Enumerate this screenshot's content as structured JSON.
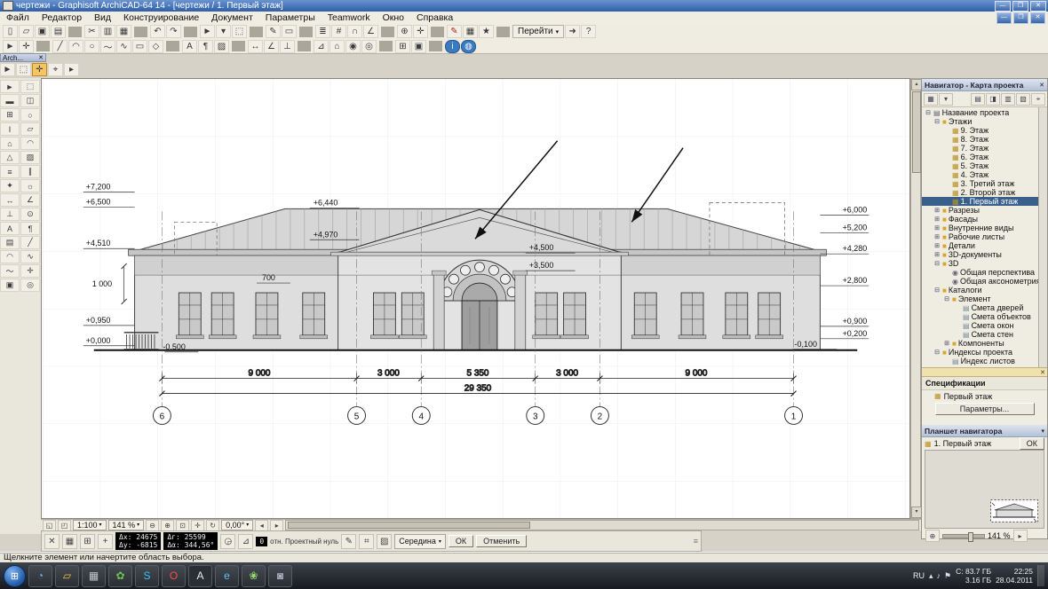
{
  "window": {
    "title": "чертежи - Graphisoft ArchiCAD-64 14 - [чертежи / 1. Первый этаж]"
  },
  "glyphs": {
    "close": "✕",
    "min": "—",
    "max": "❐",
    "dropdown": "▾",
    "up": "▴",
    "down": "▾",
    "left": "◂",
    "right": "▸",
    "grip": "≡",
    "start": "⊞",
    "plus": "+",
    "lens_minus": "⊖",
    "lens_plus": "⊕"
  },
  "menu": {
    "items": [
      {
        "name": "menu-file",
        "label": "Файл"
      },
      {
        "name": "menu-edit",
        "label": "Редактор"
      },
      {
        "name": "menu-view",
        "label": "Вид"
      },
      {
        "name": "menu-design",
        "label": "Конструирование"
      },
      {
        "name": "menu-document",
        "label": "Документ"
      },
      {
        "name": "menu-options",
        "label": "Параметры"
      },
      {
        "name": "menu-teamwork",
        "label": "Teamwork"
      },
      {
        "name": "menu-window",
        "label": "Окно"
      },
      {
        "name": "menu-help",
        "label": "Справка"
      }
    ]
  },
  "toolbar1": {
    "goto": "Перейти",
    "items": [
      {
        "n": "new-icon",
        "g": "▯"
      },
      {
        "n": "open-icon",
        "g": "▱"
      },
      {
        "n": "save-icon",
        "g": "▣"
      },
      {
        "n": "print-icon",
        "g": "▤"
      },
      {
        "cls": "sep",
        "g": ""
      },
      {
        "n": "cut-icon",
        "g": "✂"
      },
      {
        "n": "copy-icon",
        "g": "▥"
      },
      {
        "n": "paste-icon",
        "g": "▦"
      },
      {
        "cls": "sep",
        "g": ""
      },
      {
        "n": "undo-icon",
        "g": "↶"
      },
      {
        "n": "redo-icon",
        "g": "↷"
      },
      {
        "cls": "sep",
        "g": ""
      },
      {
        "n": "arrow-tool-icon",
        "g": "►"
      },
      {
        "n": "arrow-dropdown-icon",
        "g": "▾"
      },
      {
        "n": "marquee-tool-icon",
        "g": "⬚"
      },
      {
        "cls": "sep",
        "g": ""
      },
      {
        "n": "pen-icon",
        "g": "✎"
      },
      {
        "n": "eraser-icon",
        "g": "▭"
      },
      {
        "cls": "sep",
        "g": ""
      },
      {
        "n": "layers-icon",
        "g": "≣"
      },
      {
        "n": "grid-snap-icon",
        "g": "#"
      },
      {
        "n": "magnet-icon",
        "g": "∩"
      },
      {
        "n": "guideline-icon",
        "g": "∠"
      },
      {
        "cls": "sep",
        "g": ""
      },
      {
        "n": "zoom-icon",
        "g": "⊕"
      },
      {
        "n": "pan-icon",
        "g": "✛"
      },
      {
        "cls": "sep",
        "g": ""
      },
      {
        "n": "markup-pen-icon",
        "g": "✎",
        "cls": "c-red"
      },
      {
        "n": "schedule-icon",
        "g": "▦"
      },
      {
        "n": "favorites-icon",
        "g": "★"
      },
      {
        "cls": "sep",
        "g": ""
      }
    ],
    "items2": [
      {
        "n": "run-icon",
        "g": "➜"
      },
      {
        "n": "help-icon",
        "g": "?"
      }
    ]
  },
  "toolbar2": {
    "items": [
      {
        "n": "select-icon",
        "g": "►"
      },
      {
        "n": "hotspot-icon",
        "g": "✛"
      },
      {
        "cls": "sep",
        "g": ""
      },
      {
        "n": "line-icon",
        "g": "╱"
      },
      {
        "n": "arc-icon",
        "g": "◠"
      },
      {
        "n": "circle-icon",
        "g": "○"
      },
      {
        "n": "spline-icon",
        "g": "～"
      },
      {
        "n": "polyline-icon",
        "g": "∿"
      },
      {
        "n": "rect-icon",
        "g": "▭"
      },
      {
        "n": "poly-icon",
        "g": "◇"
      },
      {
        "cls": "sep",
        "g": ""
      },
      {
        "n": "text-icon",
        "g": "A"
      },
      {
        "n": "label-icon",
        "g": "¶"
      },
      {
        "n": "fill-icon",
        "g": "▨"
      },
      {
        "cls": "sep",
        "g": ""
      },
      {
        "n": "dimension-icon",
        "g": "↔"
      },
      {
        "n": "angle-dimension-icon",
        "g": "∠"
      },
      {
        "n": "level-dimension-icon",
        "g": "⊥"
      },
      {
        "cls": "sep",
        "g": ""
      },
      {
        "n": "section-icon",
        "g": "⊿"
      },
      {
        "n": "elevation-icon",
        "g": "⌂"
      },
      {
        "n": "detail-icon",
        "g": "◉"
      },
      {
        "n": "camera-icon",
        "g": "◎"
      },
      {
        "cls": "sep",
        "g": ""
      },
      {
        "n": "column-grid-icon",
        "g": "⊞"
      },
      {
        "n": "drawing-icon",
        "g": "▣"
      },
      {
        "cls": "sep",
        "g": ""
      },
      {
        "n": "info-icon",
        "g": "i",
        "cls": "c-blue"
      },
      {
        "n": "teamwork-icon",
        "g": "◍",
        "cls": "c-blue"
      }
    ]
  },
  "palette": {
    "title": "Arch...",
    "items": [
      {
        "n": "quick-arrow-icon",
        "g": "►"
      },
      {
        "n": "quick-marquee-icon",
        "g": "⬚"
      },
      {
        "n": "quick-select-icon",
        "g": "✛",
        "cls": "active"
      },
      {
        "n": "quick-snap-icon",
        "g": "⌖"
      },
      {
        "n": "quick-cursor-icon",
        "g": "▸"
      }
    ]
  },
  "toolbox": {
    "items": [
      {
        "n": "tool-arrow",
        "g": "►"
      },
      {
        "n": "tool-marquee",
        "g": "⬚"
      },
      {
        "n": "tool-wall",
        "g": "▬"
      },
      {
        "n": "tool-door",
        "g": "◫"
      },
      {
        "n": "tool-window",
        "g": "⊞"
      },
      {
        "n": "tool-column",
        "g": "○"
      },
      {
        "n": "tool-beam",
        "g": "Ι"
      },
      {
        "n": "tool-slab",
        "g": "▱"
      },
      {
        "n": "tool-roof",
        "g": "⌂"
      },
      {
        "n": "tool-shell",
        "g": "◠"
      },
      {
        "n": "tool-mesh",
        "g": "△"
      },
      {
        "n": "tool-zone",
        "g": "▨"
      },
      {
        "n": "tool-stair",
        "g": "≡"
      },
      {
        "n": "tool-railing",
        "g": "∥"
      },
      {
        "n": "tool-object",
        "g": "✦"
      },
      {
        "n": "tool-lamp",
        "g": "☼"
      },
      {
        "n": "tool-dimension",
        "g": "↔"
      },
      {
        "n": "tool-angle-dimension",
        "g": "∠"
      },
      {
        "n": "tool-level-dimension",
        "g": "⊥"
      },
      {
        "n": "tool-radial-dimension",
        "g": "⊙"
      },
      {
        "n": "tool-text",
        "g": "A"
      },
      {
        "n": "tool-label",
        "g": "¶"
      },
      {
        "n": "tool-fill",
        "g": "▤"
      },
      {
        "n": "tool-line",
        "g": "╱"
      },
      {
        "n": "tool-arc",
        "g": "◠"
      },
      {
        "n": "tool-polyline",
        "g": "∿"
      },
      {
        "n": "tool-spline",
        "g": "～"
      },
      {
        "n": "tool-hotspot",
        "g": "✛"
      },
      {
        "n": "tool-figure",
        "g": "▣"
      },
      {
        "n": "tool-camera",
        "g": "◎"
      }
    ]
  },
  "drawing": {
    "levels_left": [
      "+7,200",
      "+6,500",
      "+4,510",
      "+0,950",
      "+0,000"
    ],
    "levels_right": [
      "+6,000",
      "+5,200",
      "+4,280",
      "+2,800",
      "+0,900",
      "+0,200"
    ],
    "marks": {
      "ridge": "+6,440",
      "eaves": "+4,970",
      "left_dim": "700",
      "arch_top": "+4,500",
      "arch_spring": "+3,500",
      "left_vert": "1 000",
      "base_left": "-0,500",
      "base_right": "-0,100"
    },
    "dims": [
      "9 000",
      "3 000",
      "5 350",
      "3 000",
      "9 000"
    ],
    "dim_total": "29 350",
    "axes": [
      "6",
      "5",
      "4",
      "3",
      "2",
      "1"
    ]
  },
  "navigator": {
    "title": "Навигатор - Карта проекта",
    "header_icons_left": [
      {
        "n": "project-chooser-icon",
        "g": "▦"
      },
      {
        "n": "project-dropdown-icon",
        "g": "▾"
      }
    ],
    "header_icons_right": [
      {
        "n": "project-map-icon",
        "g": "▤"
      },
      {
        "n": "view-map-icon",
        "g": "◨"
      },
      {
        "n": "layout-book-icon",
        "g": "▥"
      },
      {
        "n": "publisher-icon",
        "g": "▧"
      },
      {
        "n": "pin-icon",
        "g": "⌖"
      }
    ],
    "tree": [
      {
        "name": "nav-project-name",
        "label": "Название проекта",
        "cls": "d0",
        "icon": "i-book",
        "ig": "▤",
        "exp": "⊟"
      },
      {
        "name": "nav-stories",
        "label": "Этажи",
        "cls": "d1",
        "icon": "i-folder",
        "ig": "■",
        "exp": "⊟"
      },
      {
        "name": "nav-story-9",
        "label": "9. Этаж",
        "cls": "d2",
        "icon": "i-floor",
        "ig": "▦",
        "exp": ""
      },
      {
        "name": "nav-story-8",
        "label": "8. Этаж",
        "cls": "d2",
        "icon": "i-floor",
        "ig": "▦",
        "exp": ""
      },
      {
        "name": "nav-story-7",
        "label": "7. Этаж",
        "cls": "d2",
        "icon": "i-floor",
        "ig": "▦",
        "exp": ""
      },
      {
        "name": "nav-story-6",
        "label": "6. Этаж",
        "cls": "d2",
        "icon": "i-floor",
        "ig": "▦",
        "exp": ""
      },
      {
        "name": "nav-story-5",
        "label": "5. Этаж",
        "cls": "d2",
        "icon": "i-floor",
        "ig": "▦",
        "exp": ""
      },
      {
        "name": "nav-story-4",
        "label": "4. Этаж",
        "cls": "d2",
        "icon": "i-floor",
        "ig": "▦",
        "exp": ""
      },
      {
        "name": "nav-story-3",
        "label": "3. Третий этаж",
        "cls": "d2",
        "icon": "i-floor",
        "ig": "▦",
        "exp": ""
      },
      {
        "name": "nav-story-2",
        "label": "2. Второй этаж",
        "cls": "d2",
        "icon": "i-floor",
        "ig": "▦",
        "exp": ""
      },
      {
        "name": "nav-story-1",
        "label": "1. Первый этаж",
        "cls": "d2 sel",
        "icon": "i-floor",
        "ig": "▦",
        "exp": ""
      },
      {
        "name": "nav-sections",
        "label": "Разрезы",
        "cls": "d1",
        "icon": "i-folder",
        "ig": "■",
        "exp": "⊞"
      },
      {
        "name": "nav-elevations",
        "label": "Фасады",
        "cls": "d1",
        "icon": "i-folder",
        "ig": "■",
        "exp": "⊞"
      },
      {
        "name": "nav-interior-views",
        "label": "Внутренние виды",
        "cls": "d1",
        "icon": "i-folder",
        "ig": "■",
        "exp": "⊞"
      },
      {
        "name": "nav-worksheets",
        "label": "Рабочие листы",
        "cls": "d1",
        "icon": "i-folder",
        "ig": "■",
        "exp": "⊞"
      },
      {
        "name": "nav-details",
        "label": "Детали",
        "cls": "d1",
        "icon": "i-folder",
        "ig": "■",
        "exp": "⊞"
      },
      {
        "name": "nav-3d-documents",
        "label": "3D-документы",
        "cls": "d1",
        "icon": "i-folder",
        "ig": "■",
        "exp": "⊞"
      },
      {
        "name": "nav-3d",
        "label": "3D",
        "cls": "d1",
        "icon": "i-folder",
        "ig": "■",
        "exp": "⊟"
      },
      {
        "name": "nav-perspective",
        "label": "Общая перспектива",
        "cls": "d2",
        "icon": "i-view",
        "ig": "◉",
        "exp": ""
      },
      {
        "name": "nav-axonometry",
        "label": "Общая аксонометрия",
        "cls": "d2",
        "icon": "i-view",
        "ig": "◉",
        "exp": ""
      },
      {
        "name": "nav-schedules",
        "label": "Каталоги",
        "cls": "d1",
        "icon": "i-folder",
        "ig": "■",
        "exp": "⊟"
      },
      {
        "name": "nav-element",
        "label": "Элемент",
        "cls": "d2",
        "icon": "i-folder",
        "ig": "■",
        "exp": "⊟"
      },
      {
        "name": "nav-door-schedule",
        "label": "Смета дверей",
        "cls": "d3",
        "icon": "i-list",
        "ig": "▤",
        "exp": ""
      },
      {
        "name": "nav-object-schedule",
        "label": "Смета объектов",
        "cls": "d3",
        "icon": "i-list",
        "ig": "▤",
        "exp": ""
      },
      {
        "name": "nav-window-schedule",
        "label": "Смета окон",
        "cls": "d3",
        "icon": "i-list",
        "ig": "▤",
        "exp": ""
      },
      {
        "name": "nav-wall-schedule",
        "label": "Смета стен",
        "cls": "d3",
        "icon": "i-list",
        "ig": "▤",
        "exp": ""
      },
      {
        "name": "nav-components",
        "label": "Компоненты",
        "cls": "d2",
        "icon": "i-folder",
        "ig": "■",
        "exp": "⊞"
      },
      {
        "name": "nav-project-indexes",
        "label": "Индексы проекта",
        "cls": "d1",
        "icon": "i-folder",
        "ig": "■",
        "exp": "⊟"
      },
      {
        "name": "nav-sheet-index",
        "label": "Индекс листов",
        "cls": "d2",
        "icon": "i-list",
        "ig": "▤",
        "exp": ""
      }
    ],
    "specs": {
      "title": "Спецификации",
      "item": "Первый этаж",
      "params_button": "Параметры..."
    },
    "panel": {
      "title": "Планшет навигатора",
      "item": "1. Первый этаж",
      "ok": "ОК",
      "zoom": "141 %"
    }
  },
  "canvas_bar": {
    "scale": "1:100",
    "zoom": "141 %",
    "rotation": "0,00°"
  },
  "coord_bar": {
    "r1a": "Δх: 24675",
    "r1b": "Δу: -6815",
    "r2a": "Δг: 25599",
    "r2b": "Δα: 344,56°",
    "r3": "0",
    "ref": "отн. Проектный нуль",
    "snap": "Середина",
    "ok": "ОК",
    "cancel": "Отменить"
  },
  "status_bar": {
    "message": "Щелкните элемент или начертите область выбора."
  },
  "taskbar": {
    "lang": "RU",
    "disk": "С: 83.7 ГБ",
    "ram": "3.16 ГБ",
    "time": "22:25",
    "date": "28.04.2011",
    "items": [
      {
        "n": "taskbar-app-blue",
        "g": "◔",
        "cls": "c-blue"
      },
      {
        "n": "taskbar-folder",
        "g": "▱",
        "cls": "c-yellow"
      },
      {
        "n": "taskbar-app-gray",
        "g": "▦",
        "cls": "c-gray"
      },
      {
        "n": "taskbar-app-flower",
        "g": "✿",
        "cls": "c-green"
      },
      {
        "n": "taskbar-skype",
        "g": "S",
        "cls": "c-skype"
      },
      {
        "n": "taskbar-opera",
        "g": "O",
        "cls": "c-opera"
      },
      {
        "n": "taskbar-archicad",
        "g": "A",
        "cls": "c-dark"
      },
      {
        "n": "taskbar-ie",
        "g": "e",
        "cls": "c-ie"
      },
      {
        "n": "taskbar-app-green",
        "g": "❀",
        "cls": "c-lgreen"
      },
      {
        "n": "taskbar-camera",
        "g": "◙",
        "cls": "c-cam"
      }
    ],
    "tray_icons": [
      {
        "n": "tray-expand-icon",
        "g": "▴"
      },
      {
        "n": "tray-sound-icon",
        "g": "♪"
      },
      {
        "n": "tray-network-icon",
        "g": "⚑"
      }
    ]
  }
}
